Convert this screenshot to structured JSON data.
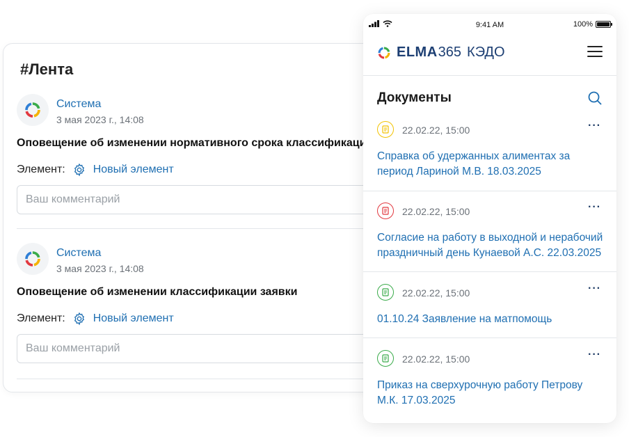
{
  "feed": {
    "title": "#Лента",
    "posts": [
      {
        "author": "Система",
        "date": "3 мая 2023 г., 14:08",
        "text": "Оповещение об изменении нормативного срока классификации заявки",
        "element_label": "Элемент:",
        "element_link": "Новый элемент",
        "comment_placeholder": "Ваш комментарий"
      },
      {
        "author": "Система",
        "date": "3 мая 2023 г., 14:08",
        "text": "Оповещение об изменении классификации заявки",
        "element_label": "Элемент:",
        "element_link": "Новый элемент",
        "comment_placeholder": "Ваш комментарий"
      }
    ]
  },
  "phone": {
    "status_bar": {
      "time": "9:41 AM",
      "battery": "100%"
    },
    "header": {
      "brand": "ELMA",
      "brand_number": "365",
      "brand_suffix": "КЭДО"
    },
    "title": "Документы",
    "documents": [
      {
        "date": "22.02.22, 15:00",
        "title": "Справка об удержанных алиментах за период Лариной М.В. 18.03.2025",
        "status_color": "#f2c200",
        "more": "···"
      },
      {
        "date": "22.02.22, 15:00",
        "title": "Согласие на работу в выходной и нерабочий праздничный день Кунаевой А.С. 22.03.2025",
        "status_color": "#e2383f",
        "more": "···"
      },
      {
        "date": "22.02.22, 15:00",
        "title": "01.10.24 Заявление на матпомощь",
        "status_color": "#3aab4a",
        "more": "···"
      },
      {
        "date": "22.02.22, 15:00",
        "title": "Приказ на сверхурочную работу Петрову М.К. 17.03.2025",
        "status_color": "#3aab4a",
        "more": "···"
      }
    ]
  },
  "colors": {
    "link": "#1f6fb2",
    "brand": "#1d3f73"
  }
}
